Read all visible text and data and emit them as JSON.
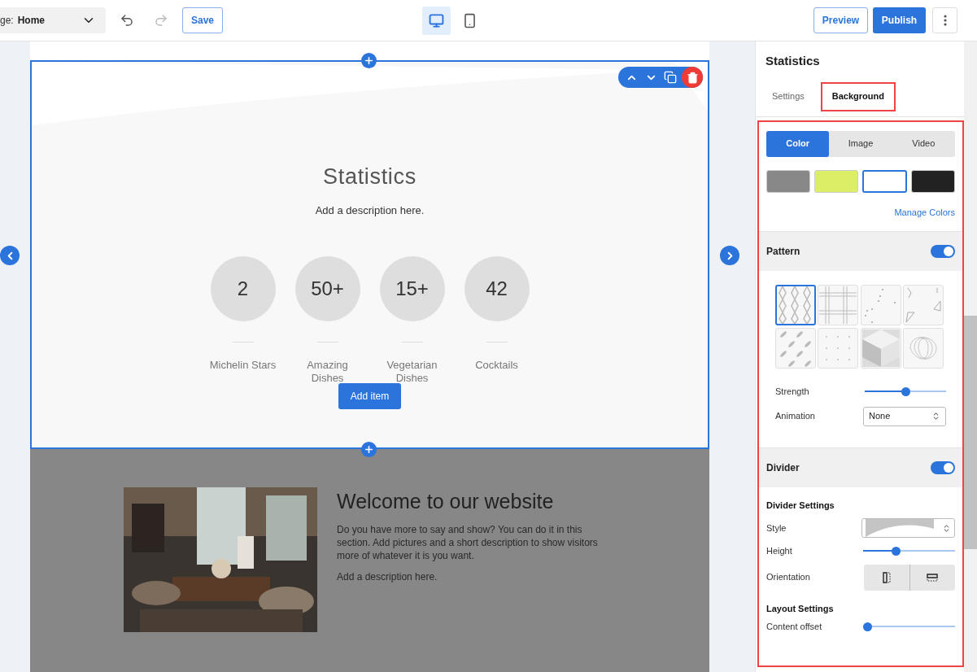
{
  "toolbar": {
    "page_select": {
      "label": "ge:",
      "value": "Home"
    },
    "undo": {
      "disabled": false
    },
    "redo": {
      "disabled": true
    },
    "save": "Save",
    "devices": [
      {
        "kind": "desktop",
        "selected": true
      },
      {
        "kind": "mobile",
        "selected": false
      }
    ],
    "preview": "Preview",
    "publish": "Publish"
  },
  "canvas": {
    "statistics": {
      "selected": true,
      "title": "Statistics",
      "description": "Add a description here.",
      "stats": [
        {
          "value": "2",
          "label": "Michelin Stars"
        },
        {
          "value": "50+",
          "label": "Amazing Dishes"
        },
        {
          "value": "15+",
          "label": "Vegetarian Dishes"
        },
        {
          "value": "42",
          "label": "Cocktails"
        }
      ],
      "add_item": "Add item"
    },
    "welcome": {
      "title": "Welcome to our website",
      "body": "Do you have more to say and show? You can do it in this section. Add pictures and a short description to show visitors more of whatever it is you want.",
      "description": "Add a description here."
    }
  },
  "panel": {
    "title": "Statistics",
    "tabs": [
      {
        "label": "Settings",
        "selected": false
      },
      {
        "label": "Background",
        "selected": true
      }
    ],
    "bg_modes": [
      {
        "label": "Color",
        "selected": true
      },
      {
        "label": "Image",
        "selected": false
      },
      {
        "label": "Video",
        "selected": false
      }
    ],
    "swatches": [
      {
        "color": "#888888",
        "selected": false
      },
      {
        "color": "#dcee66",
        "selected": false
      },
      {
        "color": "#ffffff",
        "selected": true
      },
      {
        "color": "#222222",
        "selected": false
      }
    ],
    "manage_colors": "Manage Colors",
    "pattern": {
      "label": "Pattern",
      "on": true,
      "tiles": [
        {
          "kind": "hexagons",
          "selected": true
        },
        {
          "kind": "plaid",
          "selected": false
        },
        {
          "kind": "specks",
          "selected": false
        },
        {
          "kind": "shapes",
          "selected": false
        },
        {
          "kind": "dashes",
          "selected": false
        },
        {
          "kind": "dots",
          "selected": false
        },
        {
          "kind": "cubes",
          "selected": false
        },
        {
          "kind": "contours",
          "selected": false
        }
      ],
      "strength": {
        "label": "Strength",
        "level": 0.5
      },
      "animation": {
        "label": "Animation",
        "value": "None"
      }
    },
    "divider": {
      "label": "Divider",
      "on": true,
      "settings_title": "Divider Settings",
      "style_label": "Style",
      "height": {
        "label": "Height",
        "level": 0.34
      },
      "orientation_label": "Orientation",
      "layout_title": "Layout Settings",
      "offset": {
        "label": "Content offset",
        "level": 0
      }
    }
  }
}
